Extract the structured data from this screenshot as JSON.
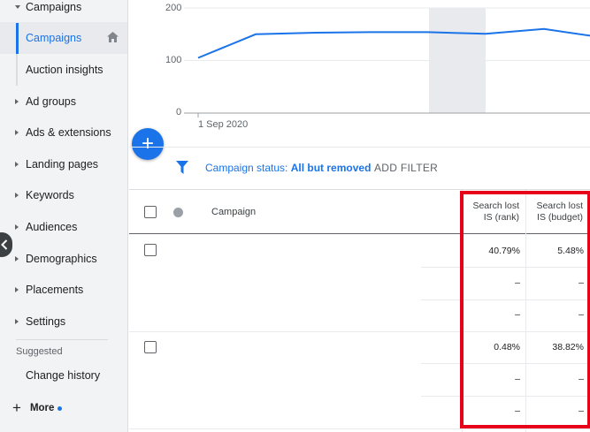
{
  "sidebar": {
    "items": [
      {
        "label": "Campaigns",
        "expanded": true
      },
      {
        "label": "Campaigns",
        "active": true
      },
      {
        "label": "Auction insights"
      },
      {
        "label": "Ad groups"
      },
      {
        "label": "Ads & extensions"
      },
      {
        "label": "Landing pages"
      },
      {
        "label": "Keywords"
      },
      {
        "label": "Audiences"
      },
      {
        "label": "Demographics"
      },
      {
        "label": "Placements"
      },
      {
        "label": "Settings"
      }
    ],
    "suggested_label": "Suggested",
    "change_history": "Change history",
    "more_label": "More"
  },
  "chart_data": {
    "type": "line",
    "x": [
      "1 Sep 2020",
      "",
      "",
      "",
      "",
      "",
      "",
      ""
    ],
    "y_ticks": [
      "200",
      "100",
      "0"
    ],
    "ylim": [
      0,
      200
    ],
    "series": [
      {
        "values": [
          105,
          150,
          153,
          154,
          154,
          151,
          160,
          145
        ],
        "color": "#1a73e8"
      }
    ],
    "x_tick_label": "1 Sep 2020"
  },
  "filter": {
    "prefix": "Campaign status: ",
    "value": "All but removed",
    "add_filter": "ADD FILTER"
  },
  "table": {
    "columns": {
      "campaign": "Campaign",
      "rank_line1": "Search lost",
      "rank_line2": "IS (rank)",
      "budget_line1": "Search lost",
      "budget_line2": "IS (budget)"
    },
    "rows": [
      {
        "rank": "40.79%",
        "budget": "5.48%"
      },
      {
        "rank": "–",
        "budget": "–"
      },
      {
        "rank": "–",
        "budget": "–"
      },
      {
        "rank": "0.48%",
        "budget": "38.82%"
      },
      {
        "rank": "–",
        "budget": "–"
      },
      {
        "rank": "–",
        "budget": "–"
      }
    ]
  },
  "colors": {
    "accent": "#1a73e8",
    "highlight": "#e6001a"
  }
}
